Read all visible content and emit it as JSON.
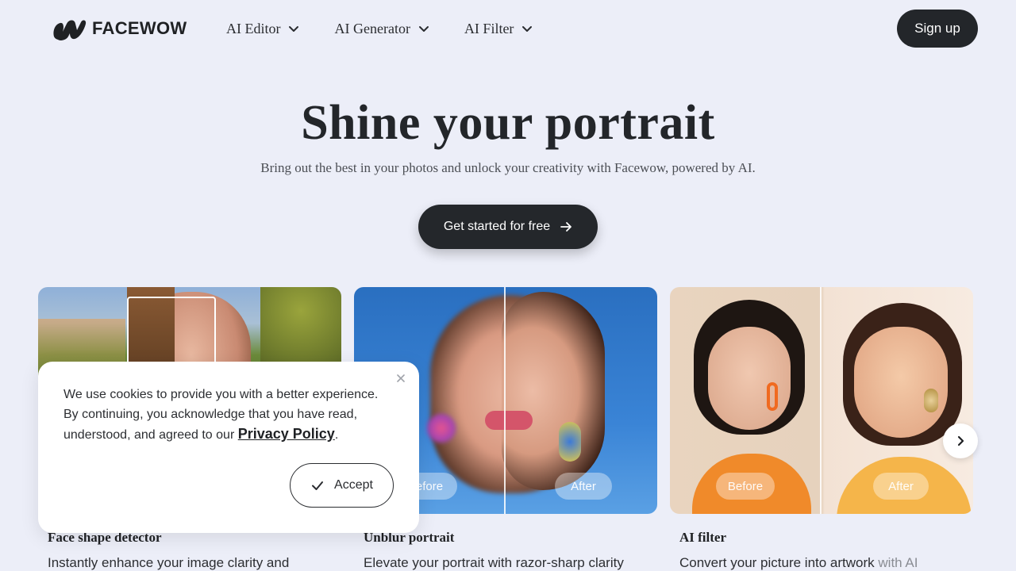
{
  "brand": {
    "name": "FACEWOW",
    "icon": "facewow-logo-icon"
  },
  "nav": {
    "items": [
      {
        "label": "AI Editor",
        "icon": "chevron-down-icon"
      },
      {
        "label": "AI Generator",
        "icon": "chevron-down-icon"
      },
      {
        "label": "AI Filter",
        "icon": "chevron-down-icon"
      }
    ],
    "signup_label": "Sign up"
  },
  "hero": {
    "title": "Shine your portrait",
    "subtitle": "Bring out the best in your photos and unlock your creativity with Facewow, powered by AI.",
    "cta_label": "Get started for free",
    "cta_icon": "arrow-right-icon"
  },
  "cards": [
    {
      "title": "Face shape detector",
      "desc": "Instantly enhance your image clarity and",
      "desc_fade": ""
    },
    {
      "title": "Unblur portrait",
      "desc": "Elevate your portrait with razor-sharp clarity",
      "desc_fade": "",
      "before_label": "Before",
      "after_label": "After"
    },
    {
      "title": "AI filter",
      "desc": "Convert your picture into artwork ",
      "desc_fade": "with AI",
      "before_label": "Before",
      "after_label": "After"
    }
  ],
  "carousel": {
    "next_icon": "chevron-right-icon"
  },
  "cookie": {
    "text": "We use cookies to provide you with a better experience. By continuing, you acknowledge that you have read, understood, and agreed to our ",
    "link": "Privacy Policy",
    "after_link": ".",
    "accept_label": "Accept",
    "accept_icon": "check-icon",
    "close_icon": "close-icon"
  },
  "colors": {
    "background": "#eceef8",
    "primary": "#23262a",
    "text": "#1f2124"
  }
}
